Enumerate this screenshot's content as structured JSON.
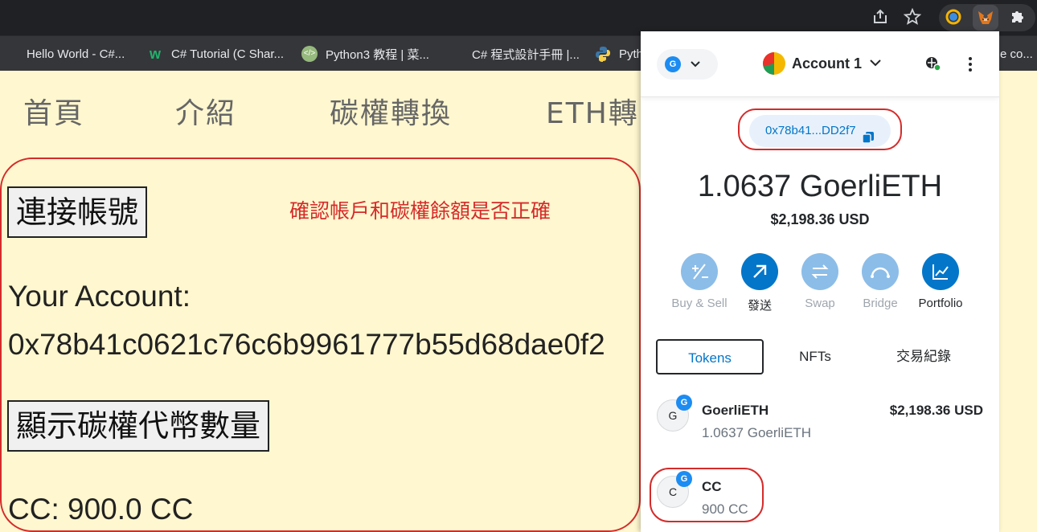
{
  "bookmarks": [
    {
      "label": "Hello World - C#..."
    },
    {
      "label": "C# Tutorial (C Shar..."
    },
    {
      "label": "Python3 教程 | 菜..."
    },
    {
      "label": "C# 程式設計手冊 |..."
    },
    {
      "label": "Pyth"
    },
    {
      "label": "e co..."
    }
  ],
  "page": {
    "nav": [
      "首頁",
      "介紹",
      "碳權轉換",
      "ETH轉"
    ],
    "connect_button": "連接帳號",
    "annotation": "確認帳戶和碳權餘額是否正確",
    "account_label": "Your Account:",
    "account_address": "0x78b41c0621c76c6b9961777b55d68dae0f2",
    "show_balance_button": "顯示碳權代幣數量",
    "cc_balance": "CC: 900.0 CC"
  },
  "wallet": {
    "network_initial": "G",
    "account_name": "Account 1",
    "address_short": "0x78b41...DD2f7",
    "balance": "1.0637 GoerliETH",
    "fiat": "$2,198.36 USD",
    "actions": [
      {
        "label": "Buy & Sell",
        "icon": "plus-minus-icon",
        "enabled": false
      },
      {
        "label": "發送",
        "icon": "send-arrow-icon",
        "enabled": true
      },
      {
        "label": "Swap",
        "icon": "swap-icon",
        "enabled": false
      },
      {
        "label": "Bridge",
        "icon": "bridge-icon",
        "enabled": false
      },
      {
        "label": "Portfolio",
        "icon": "chart-icon",
        "enabled": true
      }
    ],
    "tabs": [
      "Tokens",
      "NFTs",
      "交易紀錄"
    ],
    "active_tab": "Tokens",
    "assets": [
      {
        "initial": "G",
        "name": "GoerliETH",
        "amount": "1.0637 GoerliETH",
        "value": "$2,198.36 USD"
      },
      {
        "initial": "C",
        "name": "CC",
        "amount": "900 CC",
        "value": ""
      }
    ],
    "accent": "#0376c9",
    "disabled_accent": "#7fb7e6"
  },
  "annotation_color": "#d42b2b"
}
